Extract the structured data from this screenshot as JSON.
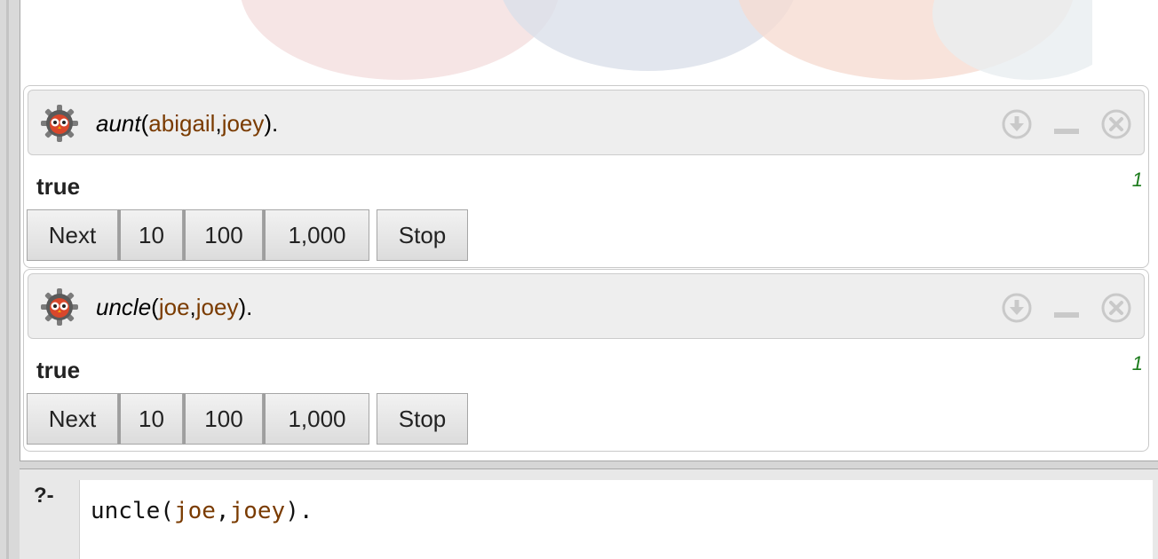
{
  "queries": [
    {
      "predicate": "aunt",
      "args": [
        "abigail",
        "joey"
      ],
      "punct": {
        "open": "(",
        "sep": ",",
        "close": ")."
      },
      "answer": "true",
      "count": "1",
      "buttons": {
        "next": "Next",
        "ten": "10",
        "hundred": "100",
        "thousand": "1,000",
        "stop": "Stop"
      }
    },
    {
      "predicate": "uncle",
      "args": [
        "joe",
        "joey"
      ],
      "punct": {
        "open": "(",
        "sep": ",",
        "close": ")."
      },
      "answer": "true",
      "count": "1",
      "buttons": {
        "next": "Next",
        "ten": "10",
        "hundred": "100",
        "thousand": "1,000",
        "stop": "Stop"
      }
    }
  ],
  "console": {
    "prompt": "?-",
    "input": {
      "predicate": "uncle",
      "args": [
        "joe",
        "joey"
      ],
      "open": "(",
      "sep": ",",
      "close": ")."
    }
  },
  "icons": {
    "query_icon": "swish-owl-gear-icon",
    "download": "download-icon",
    "minimize": "minimize-icon",
    "close": "close-icon"
  },
  "colors": {
    "atom": "#7a3b00",
    "answer_count": "#1a7a1a"
  }
}
